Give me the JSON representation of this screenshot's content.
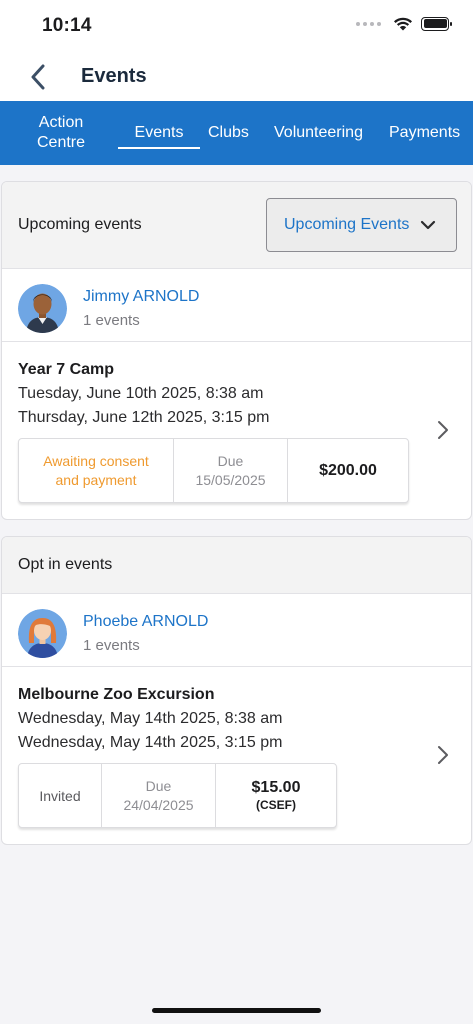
{
  "status_bar": {
    "time": "10:14"
  },
  "nav": {
    "title": "Events"
  },
  "tabs": [
    {
      "label": "Action Centre",
      "line1": "Action",
      "line2": "Centre",
      "active": false
    },
    {
      "label": "Events",
      "active": true
    },
    {
      "label": "Clubs",
      "active": false
    },
    {
      "label": "Volunteering",
      "active": false
    },
    {
      "label": "Payments",
      "active": false
    }
  ],
  "upcoming": {
    "header_title": "Upcoming events",
    "filter_value": "Upcoming Events",
    "person": {
      "name": "Jimmy ARNOLD",
      "count": "1 events"
    },
    "event": {
      "title": "Year 7 Camp",
      "start": "Tuesday, June 10th 2025, 8:38 am",
      "end": "Thursday, June 12th 2025, 3:15 pm",
      "status_line1": "Awaiting consent",
      "status_line2": "and payment",
      "due_label": "Due",
      "due_date": "15/05/2025",
      "amount": "$200.00"
    }
  },
  "optin": {
    "header_title": "Opt in events",
    "person": {
      "name": "Phoebe ARNOLD",
      "count": "1 events"
    },
    "event": {
      "title": "Melbourne Zoo Excursion",
      "start": "Wednesday, May 14th 2025, 8:38 am",
      "end": "Wednesday, May 14th 2025, 3:15 pm",
      "status": "Invited",
      "due_label": "Due",
      "due_date": "24/04/2025",
      "amount": "$15.00",
      "amount_note": "(CSEF)"
    }
  },
  "colors": {
    "accent": "#1d74c8",
    "status_orange": "#ef9a2f",
    "background": "#f4f4f7"
  },
  "icons": [
    "back-chevron-icon",
    "chevron-down-icon",
    "chevron-right-icon",
    "wifi-icon",
    "battery-icon",
    "signal-dots-icon"
  ]
}
